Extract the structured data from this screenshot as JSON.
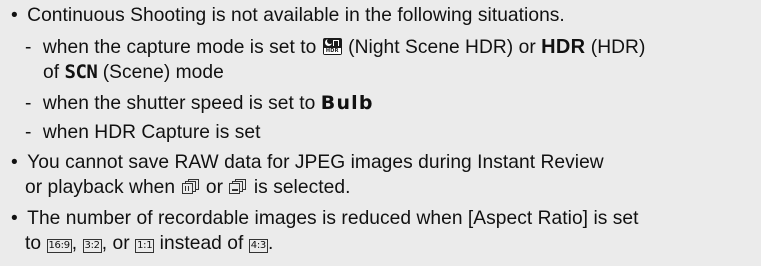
{
  "notes": [
    {
      "type": "bullet",
      "text": "Continuous Shooting is not available in the following situations."
    },
    {
      "type": "dash",
      "dash": "-",
      "before_icon": "when the capture mode is set to",
      "icon_name": "night-scene-hdr-icon",
      "after_icon": "(Night Scene HDR) or",
      "hdr_symbol": "HDR",
      "after_hdr": "(HDR)"
    },
    {
      "type": "dash-continuation",
      "prefix": "of",
      "scn_symbol": "SCN",
      "suffix": "(Scene) mode"
    },
    {
      "type": "dash",
      "dash": "-",
      "text": "when the shutter speed is set to",
      "bulb_symbol": "Bulb"
    },
    {
      "type": "dash",
      "dash": "-",
      "text": "when HDR Capture is set"
    },
    {
      "type": "bullet",
      "text": "You cannot save RAW data for JPEG images during Instant Review"
    },
    {
      "type": "bullet-continuation",
      "before_icons": "or playback when",
      "icon_1": "continuous-shooting-high-icon",
      "joiner": "or",
      "icon_2": "continuous-shooting-low-icon",
      "after_icons": "is selected."
    },
    {
      "type": "bullet",
      "text": "The number of recordable images is reduced when [Aspect Ratio] is set"
    },
    {
      "type": "bullet-continuation",
      "prefix": "to",
      "ratio_1": "16:9",
      "sep_1": ",",
      "ratio_2": "3:2",
      "sep_2": ", or",
      "ratio_3": "1:1",
      "mid": "instead of",
      "ratio_4": "4:3",
      "end": "."
    }
  ],
  "bullet_char": "•",
  "colors": {
    "background": "#ebebeb",
    "text": "#111111",
    "icon": "#1a1a1a"
  }
}
